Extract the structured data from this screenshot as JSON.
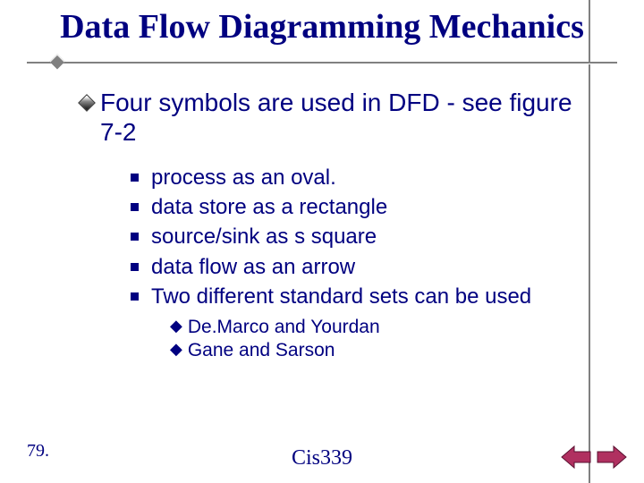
{
  "title": "Data Flow Diagramming Mechanics",
  "lvl1_text": "Four symbols are used in DFD  - see figure 7-2",
  "lvl2": [
    "process as an oval.",
    "data store as a rectangle",
    "source/sink as s square",
    "data flow as an arrow",
    "Two different standard sets can be used"
  ],
  "lvl3": [
    "De.Marco and Yourdan",
    "Gane and Sarson"
  ],
  "page_number": "79.",
  "footer": "Cis339",
  "nav": {
    "prev_fill": "#b03060",
    "next_fill": "#b03060",
    "prev_stroke": "#5a1030",
    "next_stroke": "#5a1030"
  }
}
